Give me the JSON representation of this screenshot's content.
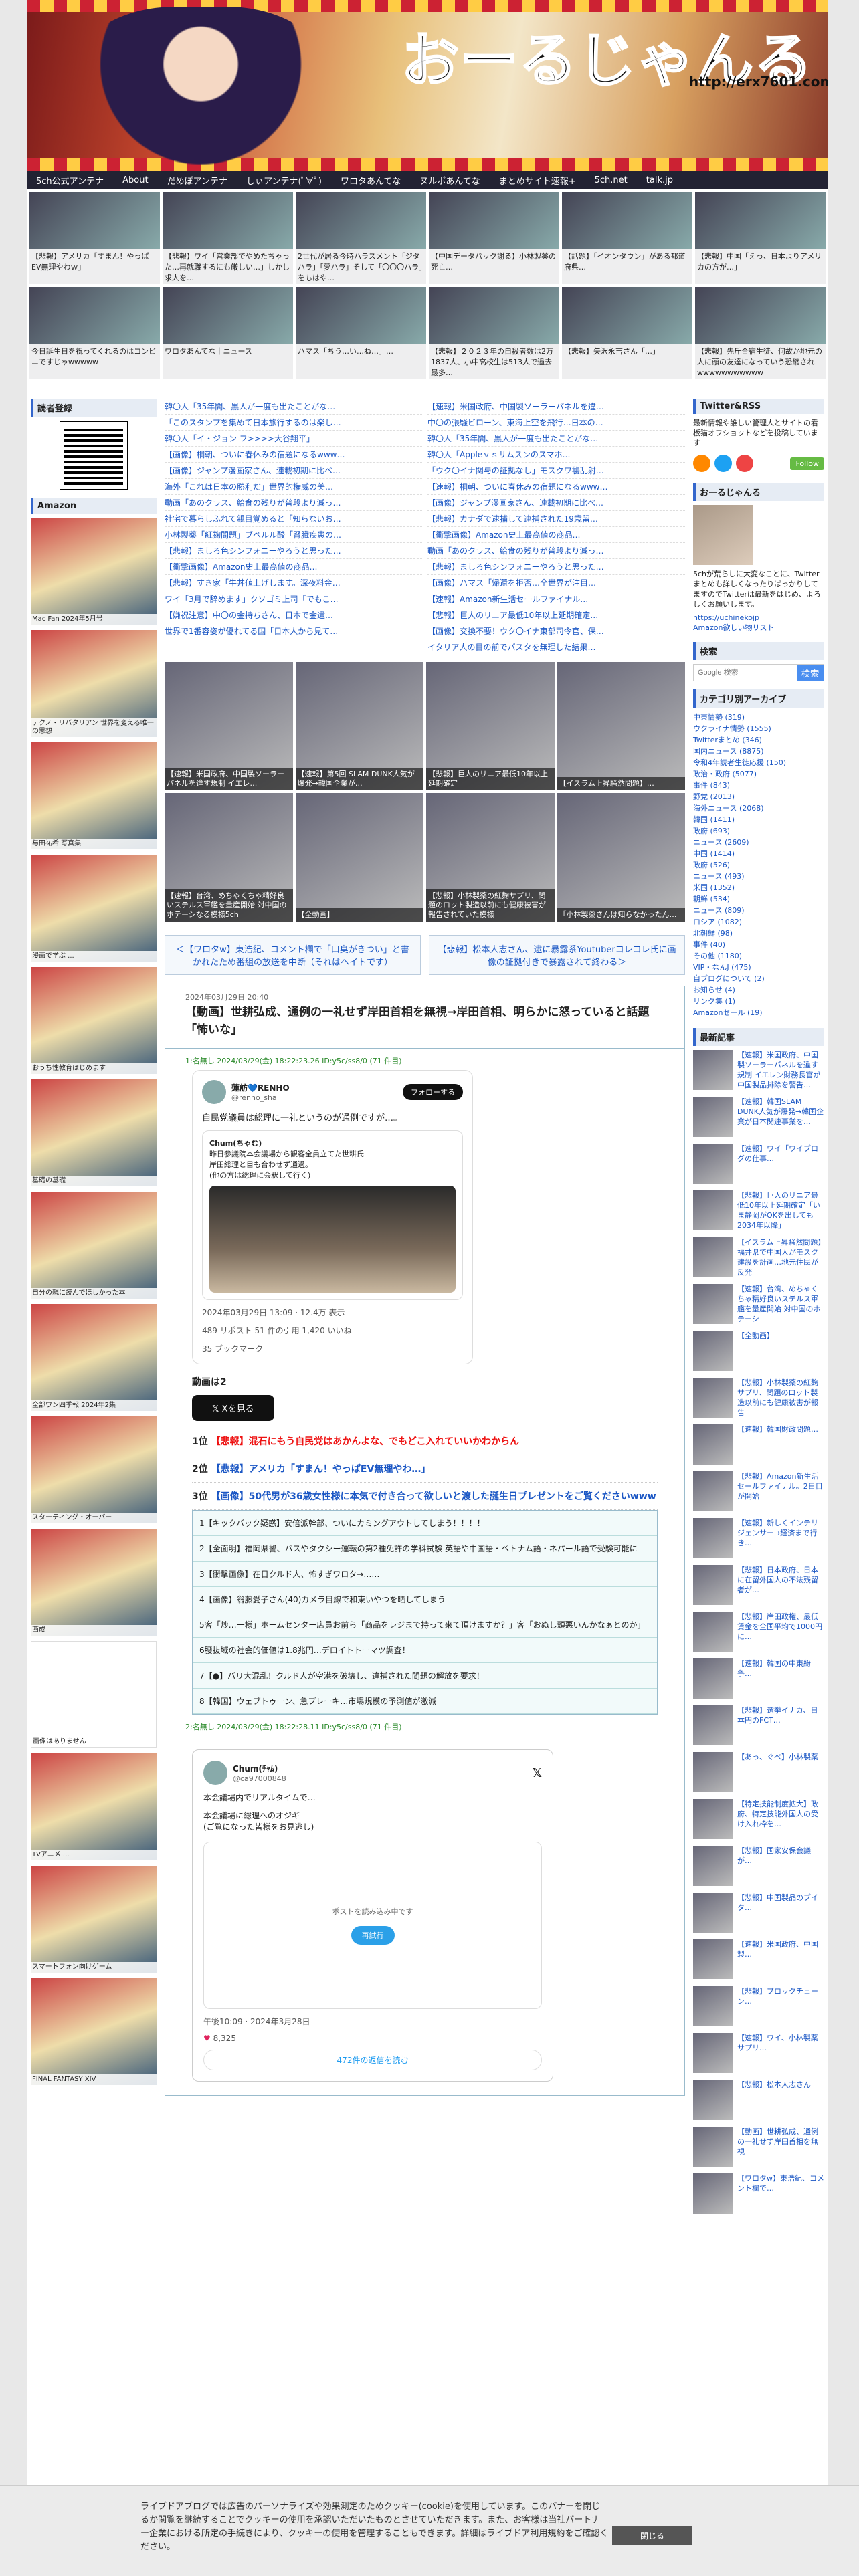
{
  "site": {
    "logo": "おーるじゃんる",
    "url": "http://erx7601.com"
  },
  "nav": [
    "5ch公式アンテナ",
    "About",
    "だめぽアンテナ",
    "しぃアンテナ(ﾟ∀ﾟ)",
    "ワロタあんてな",
    "ヌルポあんてな",
    "まとめサイト速報+",
    "5ch.net",
    "talk.jp"
  ],
  "thumbs": [
    "【悲報】アメリカ「すまん！やっぱEV無理やわｗ」",
    "【悲報】ワイ「営業部でやめたちゃった…再就職するにも厳しい…」しかし求人を…",
    "2世代が居る今時ハラスメント「ジタハラ」「夢ハラ」そして「〇〇〇ハラ」をもはや…",
    "【中国データパック謝る】小林製薬の死亡…",
    "【話題】「イオンタウン」がある都道府県…",
    "【悲報】中国「えっ、日本よりアメリカの方が…」",
    "今日誕生日を祝ってくれるのはコンビニですじゃwwwww",
    "ワロタあんてな｜ニュース",
    "ハマス「ちう…い…ね…」…",
    "【悲報】２０２３年の自殺者数は2万1837人、小中高校生は513人で過去最多…",
    "【悲報】矢沢永吉さん「…」",
    "【悲報】先斤合宿生徒、何故か地元の人に頭の友達になっていう恐縮されwwwwwwwwwww"
  ],
  "sidebar_left": {
    "reader_title": "読者登録",
    "amazon_title": "Amazon",
    "books": [
      "Mac Fan 2024年5月号",
      "テクノ・リバタリアン 世界を変える唯一の思想",
      "与田祐希 写真集",
      "漫画で学ぶ ...",
      "おうち性教育はじめます",
      "基礎の基礎",
      "自分の親に読んでほしかった本",
      "全部ワン四季報 2024年2集",
      "スターティング・オーバー",
      "西成",
      "画像はありません",
      "TVアニメ ... ",
      "スマートフォン向けゲーム",
      "FINAL FANTASY XIV"
    ]
  },
  "rank_left": [
    "韓〇人「35年間、黒人が一度も出たことがな…",
    "「このスタンプを集めて日本旅行するのは楽し…",
    "韓〇人「イ・ジョン フ>>>>大谷翔平」",
    "【画像】桐朝、ついに春休みの宿題になるwww…",
    "【画像】ジャンプ漫画家さん、連載初期に比べ…",
    "海外「これは日本の勝利だ」世界的権威の美…",
    "動画「あのクラス、給食の残りが普段より減っ…",
    "社宅で暮らしふれて親目覚めると「知らないお…",
    "小林製薬「紅麹問題」ブベルル酸「腎臓疾患の…",
    "【悲報】ましろ色シンフォニーやろうと思った…",
    "【衝撃画像】Amazon史上最高値の商品…",
    "【悲報】すき家「牛丼値上げします。深夜料金…",
    "ワイ「3月で辞めます」クソゴミ上司「でもこ…",
    "【嫌祝注意】中〇の金持ちさん、日本で金遣…",
    "世界で1番容姿が優れてる国「日本人から見て…"
  ],
  "rank_right": [
    "【速報】米国政府、中国製ソーラーパネルを違…",
    "中〇の張騒ビローン、東海上空を飛行…日本の…",
    "韓〇人「35年間、黒人が一度も出たことがな…",
    "韓〇人「Appleｖｓサムスンのスマホ…",
    "「ウク〇イナ関与の証拠なし」モスクワ襲乱射…",
    "【速報】桐朝、ついに春休みの宿題になるwww…",
    "【画像】ジャンプ漫画家さん、連載初期に比べ…",
    "【悲報】カナダで逮捕して連捕された19歳留…",
    "【衝撃画像】Amazon史上最高値の商品…",
    "動画「あのクラス、給食の残りが普段より減っ…",
    "【悲報】ましろ色シンフォニーやろうと思った…",
    "【画像】ハマス「帰還を拒否…全世界が注目…",
    "【速報】Amazon新生活セールファイナル…",
    "【悲報】巨人のリニア最低10年以上延期確定…",
    "【画像】交換不要！ウク〇イナ東部司令官、保…",
    "イタリア人の目の前でパスタを無理した結果…"
  ],
  "picks": [
    "【速報】米国政府、中国製ソーラーパネルを違す規制 イエレ…",
    "【速報】第5回 SLAM DUNK人気が爆発→韓国企業が…",
    "【悲報】巨人のリニア最低10年以上延期確定",
    "【イスラム上昇騒然問題】…",
    "【速報】台湾、めちゃくちゃ精好良いステルス軍艦を量産開始 対中国のホテーシなる模様5ch",
    "【全動画】",
    "【悲報】小林製薬の紅麹サプリ、問題のロット製造以前にも健康被害が報告されていた模様",
    "「小林製薬さんは知らなかったん…"
  ],
  "pager": {
    "prev": "＜【ワロタw】東浩紀、コメント欄で「口臭がきつい」と書かれたため番組の放送を中断（それはヘイトです）",
    "next": "【悲報】松本人志さん、逮に暴露系Youtuberコレコレ氏に画像の証拠付きで暴露されて終わる＞"
  },
  "post": {
    "date": "2024年03月29日 20:40",
    "title": "【動画】世耕弘成、通例の一礼せず岸田首相を無視→岸田首相、明らかに怒っていると話題「怖いな」",
    "res1": "1:名無し 2024/03/29(金) 18:22:23.26 ID:y5c/ss8/0 (71 件目)",
    "tweet": {
      "name": "蓮舫💙RENHO",
      "handle": "@renho_sha",
      "follow": "フォローする",
      "text": "自民党議員は総理に一礼というのが通例ですが…。",
      "quoted_name": "Chum(ちゃむ)",
      "quoted_text": "昨日参議院本会議場から観客全員立てた世耕氏",
      "quoted_text2": "岸田総理と目も合わせず通過。",
      "quoted_text3": "(他の方は総理に会釈して行く)",
      "time": "2024年03月29日 13:09 · 12.4万 表示",
      "stats": "489 リポスト  51 件の引用  1,420 いいね",
      "bookmarks": "35 ブックマーク"
    },
    "videos": "動画は2",
    "x_button": "Xを見る",
    "topics": [
      {
        "n": "1位",
        "t": "【悲報】混石にもう自民党はあかんよな、でもどこ入れていいかわからん",
        "red": true
      },
      {
        "n": "2位",
        "t": "【悲報】アメリカ「すまん！やっぱEV無理やわ…」",
        "red": false
      },
      {
        "n": "3位",
        "t": "【画像】50代男が36歳女性様に本気で付き合って欲しいと渡した誕生日プレゼントをご覧くださいwww",
        "red": false
      }
    ],
    "related": [
      "1【キックバック疑惑】安倍派幹部、ついにカミングアウトしてしまう！！！！",
      "2【全面明】福岡県警、バスやタクシー運転の第2種免許の学科試験 英語や中国語・ベトナム語・ネパール語で受験可能に",
      "3【衝撃画像】在日クルド人、怖すぎワロタ→……",
      "4【画像】翁藤愛子さん(40)カメラ目線で和東いやつを晒してしまう",
      "5客「炒…一様」ホームセンター店員お前ら「商品をレジまで持って来て頂けますか？」客「おぬし頭悪いんかなぁとのか」",
      "6腰抜域の社会的価値は1.8兆円…デロイトトーマツ調査！",
      "7【●】バリ大混乱！クルド人が空港を破壊し、違捕された間題の解放を要求！",
      "8【韓国】ウェブトゥーン、急ブレーキ…市場規模の予測値が激減"
    ],
    "res2": "2:名無し 2024/03/29(金) 18:22:28.11 ID:y5c/ss8/0 (71 件目)",
    "tweet2": {
      "name": "Chum(ﾁｬﾑ)",
      "handle": "@ca97000848",
      "line1": "本会議場内でリアルタイムで…",
      "line2": "本会議場に総理へのオジギ",
      "line3": "(ご覧になった皆様をお見逃し)",
      "placeholder": "ポストを読み込み中です",
      "blue_btn": "再試行",
      "time": "午後10:09 · 2024年3月28日",
      "likes": "8,325",
      "more": "472件の返信を読む"
    }
  },
  "sidebar_right": {
    "twitter_title": "Twitter&RSS",
    "twitter_text": "最新情報や誰しい管理人とサイトの看板猫オフショットなどを投稿しています",
    "follow_btn": "Follow",
    "profile_title": "おーるじゃんる",
    "profile_text": "5chが荒らしに大変なことに、Twitterまとめも詳しくなったりばっかりしてますのでTwitterは最新をはじめ、よろしくお願いします。",
    "profile_link": "https://uchinekojp",
    "amazon_link": "Amazon欲しい物リスト",
    "search_title": "検索",
    "search_placeholder": "Google 検索",
    "search_btn": "検索",
    "cat_title": "カテゴリ別アーカイブ",
    "cats": [
      "中東情勢 (319)",
      "ウクライナ情勢 (1555)",
      "Twitterまとめ (346)",
      "国内ニュース (8875)",
      "令和4年読者生徒応援 (150)",
      "政治・政府 (5077)",
      "事件 (843)",
      "野党 (2013)",
      "海外ニュース (2068)",
      "韓国 (1411)",
      "政府 (693)",
      "ニュース (2609)",
      "中国 (1414)",
      "政府 (526)",
      "ニュース (493)",
      "米国 (1352)",
      "朝鮮 (534)",
      "ニュース (809)",
      "ロシア (1082)",
      "北朝鮮 (98)",
      "事件 (40)",
      "その他 (1180)",
      "VIP・なんJ (475)",
      "自ブログについて (2)",
      "お知らせ (4)",
      "リンク集 (1)",
      "Amazonセール (19)"
    ],
    "recent_title": "最新記事",
    "recent": [
      "【速報】米国政府、中国製ソーラーパネルを違す規制 イエレン財務長官が中国製品排除を警告…",
      "【速報】韓国SLAM DUNK人気が爆発→韓国企業が日本関連事業を…",
      "【速報】ワイ「ワイブログの仕事…",
      "【悲報】巨人のリニア最低10年以上延期確定「いま静岡がOKを出しても2034年以降」",
      "【イスラム上昇騒然問題】福井県で中国人がモスク建設を計画…地元住民が反発",
      "【速報】台湾、めちゃくちゃ精好良いステルス軍艦を量産開始 対中国のホテーシ",
      "【全動画】",
      "【悲報】小林製薬の紅麹サプリ、問題のロット製造以前にも健康被害が報告",
      "【速報】韓国財政問題…",
      "【悲報】Amazon新生活セールファイナル。2日目が開始",
      "【速報】新しくインテリジェンサー→経済まで行き…",
      "【悲報】日本政府、日本に在留外国人の不法残留者が…",
      "【悲報】岸田政権、最低賃金を全国平均で1000円に…",
      "【速報】韓国の中東紛争…",
      "【悲報】選挙イナカ、日本円のFCT…",
      "【あっ、ぐべ】小林製薬",
      "【特定技能制度拡大】政府、特定技能外国人の受け入れ枠を…",
      "【悲報】国家安保会議が…",
      "【悲報】中国製品のブイタ…",
      "【速報】米国政府、中国製…",
      "【悲報】ブロックチェーン…",
      "【速報】ワイ、小林製薬サプリ…",
      "【悲報】松本人志さん",
      "【動画】世耕弘成、通例の一礼せず岸田首相を無視",
      "【ワロタw】東浩紀、コメント欄で…"
    ]
  },
  "cookie": {
    "text": "ライブドアブログでは広告のパーソナライズや効果測定のためクッキー(cookie)を使用しています。このバナーを閉じるか閲覧を継続することでクッキーの使用を承認いただいたものとさせていただきます。また、お客様は当社パートナー企業における所定の手続きにより、クッキーの使用を管理することもできます。詳細はライブドア利用規約をご確認ください。",
    "button": "閉じる"
  },
  "colors": {
    "nav_bg": "#223",
    "link": "#1a56c4",
    "accent_red": "#e11",
    "border_blue": "#9bc"
  }
}
